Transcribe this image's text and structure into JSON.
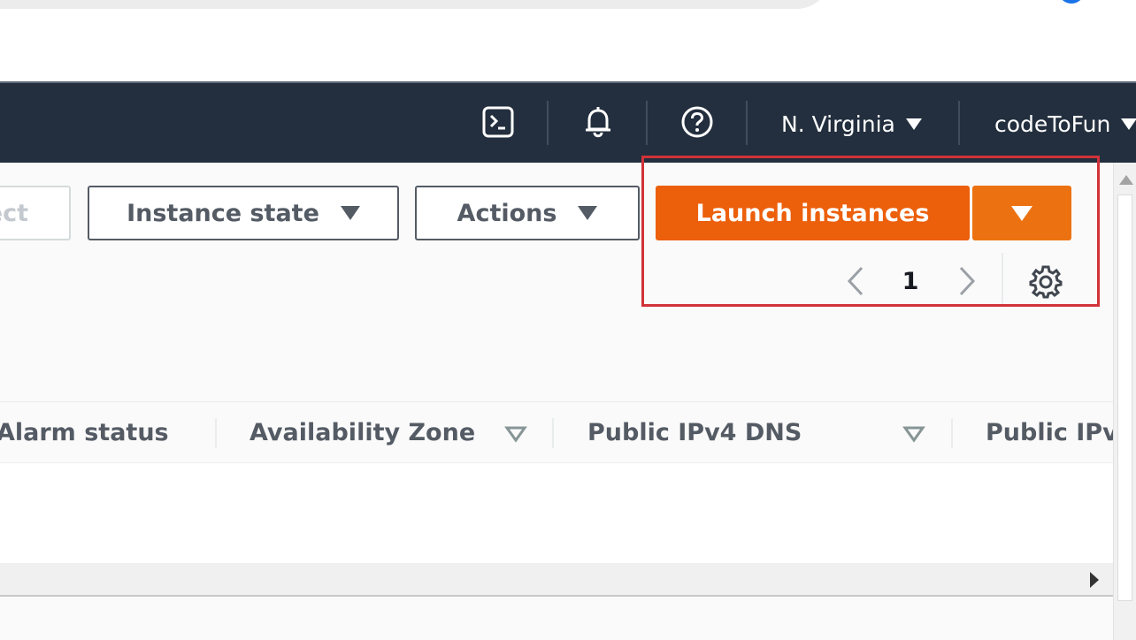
{
  "header": {
    "icons": [
      "cloudshell-icon",
      "bell-icon",
      "help-icon"
    ],
    "region_label": "N. Virginia",
    "account_label": "codeToFun"
  },
  "toolbar": {
    "connect_label": "ect",
    "instance_state_label": "Instance state",
    "actions_label": "Actions",
    "launch_label": "Launch instances"
  },
  "pagination": {
    "current_page": "1"
  },
  "table": {
    "columns": [
      {
        "label": "Alarm status",
        "sortable": false
      },
      {
        "label": "Availability Zone",
        "sortable": true
      },
      {
        "label": "Public IPv4 DNS",
        "sortable": true
      },
      {
        "label": "Public IPv",
        "sortable": false
      }
    ]
  },
  "colors": {
    "header_bg": "#232f3e",
    "launch_primary": "#ec5f0b",
    "launch_dropdown": "#ec7211",
    "highlight": "#d13239"
  }
}
